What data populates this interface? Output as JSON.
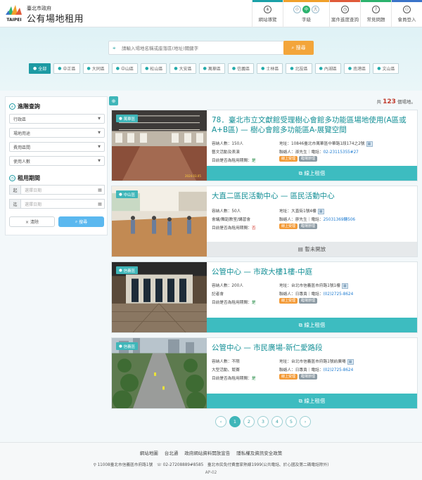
{
  "header": {
    "org": "臺北市政府",
    "system": "公有場地租用",
    "logo_text": "TAIPEI",
    "nav": [
      {
        "label": "網站導覽",
        "icon": "sitemap-icon"
      },
      {
        "label": "字級",
        "icon": "font-size-icon"
      },
      {
        "label": "案件進度查詢",
        "icon": "clock-icon"
      },
      {
        "label": "常見問題",
        "icon": "question-icon"
      },
      {
        "label": "會員登入",
        "icon": "user-icon"
      }
    ],
    "font_sizes": [
      "小",
      "中",
      "大"
    ]
  },
  "search": {
    "placeholder": "請輸入場地名稱或座落區(地址)關鍵字",
    "button": "搜尋"
  },
  "districts": [
    "全部",
    "中正區",
    "大同區",
    "中山區",
    "松山區",
    "大安區",
    "萬華區",
    "信義區",
    "士林區",
    "北投區",
    "內湖區",
    "南港區",
    "文山區"
  ],
  "sidebar": {
    "advanced_title": "進階查詢",
    "filters": [
      "行政區",
      "場地用途",
      "費用區間",
      "使用人數"
    ],
    "period_title": "租用期間",
    "start_label": "起",
    "end_label": "迄",
    "date_placeholder": "選擇日期",
    "clear": "× 清除",
    "search": "搜尋"
  },
  "results": {
    "prefix": "共",
    "count": "123",
    "suffix": "個場地。"
  },
  "cards": [
    {
      "tag": "萬華區",
      "title": "78．臺北市立文獻館受理樹心會館多功能區場地使用(A區或A+B區) — 樹心會館多功能區A-展覽空間",
      "capacity": "容納人數：150人",
      "address": "地址：10846臺北市萬華區中華路1段174之2號",
      "usage": "藝文活動及表演",
      "contact": "聯絡人：孫先生｜電話：",
      "phone": "02-23115355#27",
      "avail_label": "目前是否為租用期間：",
      "avail": "是",
      "badge1": "線上受理",
      "badge2": "臨場辦理",
      "action": "線上租借",
      "photo_date": "2024.03.05"
    },
    {
      "tag": "中山區",
      "title": "大直二區民活動中心 — 區民活動中心",
      "capacity": "容納人數：50人",
      "address": "地址：大直街1號4樓",
      "usage": "會議/舞蹈教室/講習會",
      "contact": "聯絡人：廖先生｜電話：",
      "phone": "25031369轉506",
      "avail_label": "目前是否為租用期間：",
      "avail": "否",
      "badge1": "線上受理",
      "badge2": "臨場辦理",
      "action": "暫未開放"
    },
    {
      "tag": "信義區",
      "title": "公管中心 — 市政大樓1樓-中庭",
      "capacity": "容納人數：200人",
      "address": "地址：台北市信義區市府路1號1樓",
      "usage": "記者會",
      "contact": "聯絡人：日專責｜電話：",
      "phone": "(02)2725-8624",
      "avail_label": "目前是否為租用期間：",
      "avail": "是",
      "badge1": "線上受理",
      "badge2": "臨場辦理",
      "action": "線上租借"
    },
    {
      "tag": "信義區",
      "title": "公管中心 — 市民廣場-新仁愛路段",
      "capacity": "容納人數：不限",
      "address": "地址：台北市信義區市府路1號前廣場",
      "usage": "大型活動、競賽",
      "contact": "聯絡人：日專責｜電話：",
      "phone": "(02)2725-8624",
      "avail_label": "目前是否為租用期間：",
      "avail": "是",
      "badge1": "線上受理",
      "badge2": "臨場辦理",
      "action": "線上租借"
    }
  ],
  "pager": {
    "prev": "‹",
    "pages": [
      "1",
      "2",
      "3",
      "4",
      "5"
    ],
    "next": "›"
  },
  "footer": {
    "links": [
      "網站地圖",
      "台北通",
      "政府網站資料開放宣告",
      "隱私權及資訊安全政策"
    ],
    "address": "11008臺北市信義區市府路1號　☏ 02-27208889#8585　臺北市民免付費當家熱線1999(公共電話、於心國及第二碼電話除外)",
    "code": "AP-02"
  },
  "colors": {
    "teal": "#3fb6b9",
    "orange": "#f3a53a",
    "red_count": "#c0392b"
  }
}
